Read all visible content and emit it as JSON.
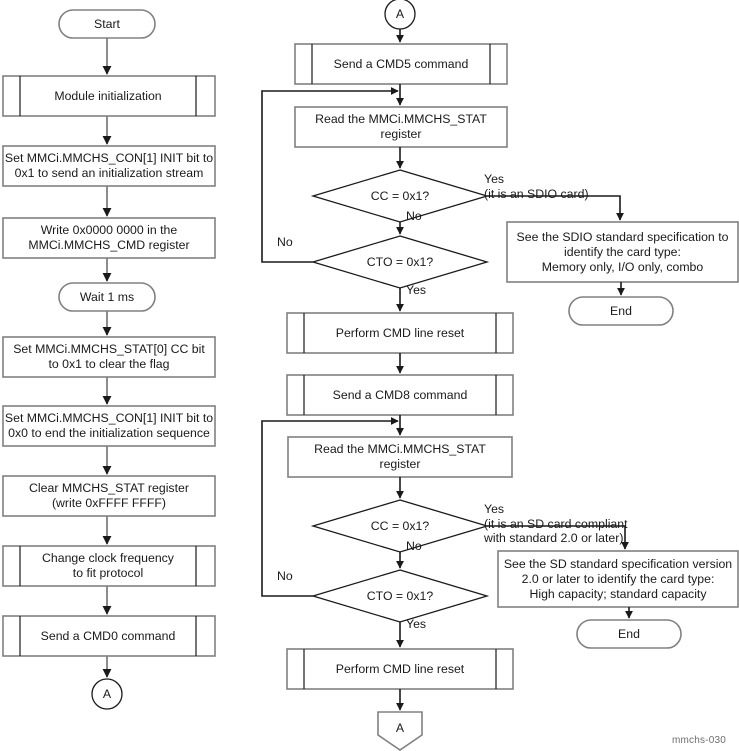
{
  "diagram": {
    "id_footer": "mmchs-030",
    "colors": {
      "stroke_dark": "#808080",
      "stroke_black": "#1a1a1a",
      "fill": "#ffffff",
      "text": "#1a1a1a",
      "footer_text": "#6e6e6e"
    },
    "left_column": {
      "start": {
        "label": "Start",
        "shape": "terminator"
      },
      "module_init": {
        "label": "Module initialization",
        "shape": "predefined-process"
      },
      "set_init_bit_1": {
        "label": "Set MMCi.MMCHS_CON[1] INIT bit to\n0x1 to send an initialization stream",
        "shape": "process"
      },
      "write_cmd_reg": {
        "label": "Write 0x0000 0000 in the\nMMCi.MMCHS_CMD register",
        "shape": "process"
      },
      "wait_1ms": {
        "label": "Wait 1 ms",
        "shape": "terminator"
      },
      "clear_cc_flag": {
        "label": "Set MMCi.MMCHS_STAT[0] CC bit\nto 0x1 to clear the flag",
        "shape": "process"
      },
      "set_init_bit_0": {
        "label": "Set MMCi.MMCHS_CON[1] INIT bit to\n0x0 to end the initialization sequence",
        "shape": "process"
      },
      "clear_stat_reg": {
        "label": "Clear MMCHS_STAT register\n(write 0xFFFF FFFF)",
        "shape": "process"
      },
      "change_clock": {
        "label": "Change clock frequency\nto fit protocol",
        "shape": "predefined-process"
      },
      "send_cmd0": {
        "label": "Send a CMD0 command",
        "shape": "predefined-process"
      },
      "connector_a_out": {
        "label": "A",
        "shape": "circle-connector"
      }
    },
    "right_column": {
      "connector_a_in": {
        "label": "A",
        "shape": "circle-connector"
      },
      "send_cmd5": {
        "label": "Send a CMD5 command",
        "shape": "predefined-process"
      },
      "read_stat_1": {
        "label": "Read the MMCi.MMCHS_STAT\nregister",
        "shape": "process"
      },
      "cc_decision_1": {
        "label": "CC = 0x1?",
        "shape": "decision"
      },
      "cto_decision_1": {
        "label": "CTO = 0x1?",
        "shape": "decision"
      },
      "cmd_line_reset_1": {
        "label": "Perform CMD line reset",
        "shape": "predefined-process"
      },
      "send_cmd8": {
        "label": "Send a CMD8 command",
        "shape": "predefined-process"
      },
      "read_stat_2": {
        "label": "Read the MMCi.MMCHS_STAT\nregister",
        "shape": "process"
      },
      "cc_decision_2": {
        "label": "CC = 0x1?",
        "shape": "decision"
      },
      "cto_decision_2": {
        "label": "CTO = 0x1?",
        "shape": "decision"
      },
      "cmd_line_reset_2": {
        "label": "Perform CMD line reset",
        "shape": "predefined-process"
      },
      "connector_a_bottom": {
        "label": "A",
        "shape": "off-page-connector"
      },
      "sdio_spec_box": {
        "label": "See the SDIO standard specification to\nidentify the card type:\nMemory only, I/O only, combo",
        "shape": "process"
      },
      "end_1": {
        "label": "End",
        "shape": "terminator"
      },
      "sd_spec_box": {
        "label": "See the SD standard specification version\n2.0 or later to identify the card type:\nHigh capacity; standard capacity",
        "shape": "process"
      },
      "end_2": {
        "label": "End",
        "shape": "terminator"
      }
    },
    "edge_labels": {
      "cc1_yes": "Yes\n(it is an SDIO card)",
      "cc1_no": "No",
      "cto1_no": "No",
      "cto1_yes": "Yes",
      "cc2_yes": "Yes\n(it is an SD card compliant\nwith standard 2.0 or later)",
      "cc2_no": "No",
      "cto2_no": "No",
      "cto2_yes": "Yes"
    }
  }
}
